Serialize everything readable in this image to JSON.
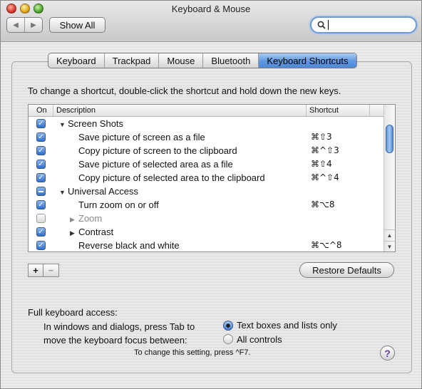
{
  "window": {
    "title": "Keyboard & Mouse"
  },
  "toolbar": {
    "back_glyph": "◀",
    "forward_glyph": "▶",
    "show_all_label": "Show All",
    "search_value": ""
  },
  "tabs": [
    {
      "label": "Keyboard",
      "active": false
    },
    {
      "label": "Trackpad",
      "active": false
    },
    {
      "label": "Mouse",
      "active": false
    },
    {
      "label": "Bluetooth",
      "active": false
    },
    {
      "label": "Keyboard Shortcuts",
      "active": true
    }
  ],
  "instruction": "To change a shortcut, double-click the shortcut and hold down the new keys.",
  "list": {
    "headers": {
      "on": "On",
      "description": "Description",
      "shortcut": "Shortcut"
    },
    "rows": [
      {
        "state": "checked",
        "kind": "group",
        "expanded": true,
        "label": "Screen Shots",
        "shortcut": ""
      },
      {
        "state": "checked",
        "kind": "item",
        "label": "Save picture of screen as a file",
        "shortcut": "⌘⇧3"
      },
      {
        "state": "checked",
        "kind": "item",
        "label": "Copy picture of screen to the clipboard",
        "shortcut": "⌘^⇧3"
      },
      {
        "state": "checked",
        "kind": "item",
        "label": "Save picture of selected area as a file",
        "shortcut": "⌘⇧4"
      },
      {
        "state": "checked",
        "kind": "item",
        "label": "Copy picture of selected area to the clipboard",
        "shortcut": "⌘^⇧4"
      },
      {
        "state": "mixed",
        "kind": "group",
        "expanded": true,
        "label": "Universal Access",
        "shortcut": ""
      },
      {
        "state": "checked",
        "kind": "item",
        "label": "Turn zoom on or off",
        "shortcut": "⌘⌥8"
      },
      {
        "state": "unchecked",
        "kind": "subgroup",
        "expanded": false,
        "dim": true,
        "label": "Zoom",
        "shortcut": ""
      },
      {
        "state": "checked",
        "kind": "subgroup",
        "expanded": false,
        "label": "Contrast",
        "shortcut": ""
      },
      {
        "state": "checked",
        "kind": "item",
        "label": "Reverse black and white",
        "shortcut": "⌘⌥^8"
      }
    ]
  },
  "buttons": {
    "add": "+",
    "remove": "−",
    "restore_defaults": "Restore Defaults",
    "help": "?"
  },
  "keyboard_access": {
    "heading": "Full keyboard access:",
    "desc_line1": "In windows and dialogs, press Tab to",
    "desc_line2": "move the keyboard focus between:",
    "options": [
      {
        "label": "Text boxes and lists only",
        "selected": true
      },
      {
        "label": "All controls",
        "selected": false
      }
    ],
    "note": "To change this setting, press ^F7."
  }
}
